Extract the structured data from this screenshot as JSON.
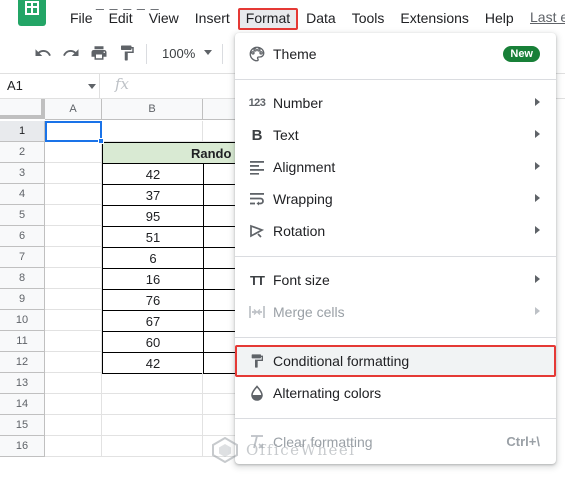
{
  "app": {
    "title_peek": "_ _ _ _ _",
    "last_edit": "Last e"
  },
  "menubar": {
    "items": [
      "File",
      "Edit",
      "View",
      "Insert",
      "Format",
      "Data",
      "Tools",
      "Extensions",
      "Help"
    ],
    "active": "Format"
  },
  "toolbar": {
    "zoom": "100%",
    "icons": [
      "undo-icon",
      "redo-icon",
      "print-icon",
      "paint-format-icon"
    ]
  },
  "formula_bar": {
    "name_box": "A1",
    "fx": "fx",
    "value": ""
  },
  "grid": {
    "columns": [
      "A",
      "B",
      ""
    ],
    "rows": [
      "1",
      "2",
      "3",
      "4",
      "5",
      "6",
      "7",
      "8",
      "9",
      "10",
      "11",
      "12",
      "13",
      "14",
      "15",
      "16"
    ],
    "header_cell": "Rando",
    "values": [
      "42",
      "37",
      "95",
      "51",
      "6",
      "16",
      "76",
      "67",
      "60",
      "42"
    ],
    "selected_cell": "A1"
  },
  "format_menu": {
    "theme": {
      "label": "Theme",
      "badge": "New"
    },
    "number": {
      "label": "Number"
    },
    "text": {
      "label": "Text"
    },
    "alignment": {
      "label": "Alignment"
    },
    "wrapping": {
      "label": "Wrapping"
    },
    "rotation": {
      "label": "Rotation"
    },
    "font_size": {
      "label": "Font size"
    },
    "merge_cells": {
      "label": "Merge cells"
    },
    "conditional_formatting": {
      "label": "Conditional formatting"
    },
    "alternating_colors": {
      "label": "Alternating colors"
    },
    "clear_formatting": {
      "label": "Clear formatting",
      "shortcut": "Ctrl+\\"
    }
  },
  "watermark": {
    "text": "OfficeWheel"
  },
  "colors": {
    "accent_red": "#e53935",
    "selection_blue": "#1a73e8",
    "badge_green": "#188038",
    "header_fill": "#d9ead3",
    "sheets_green": "#23a566"
  }
}
